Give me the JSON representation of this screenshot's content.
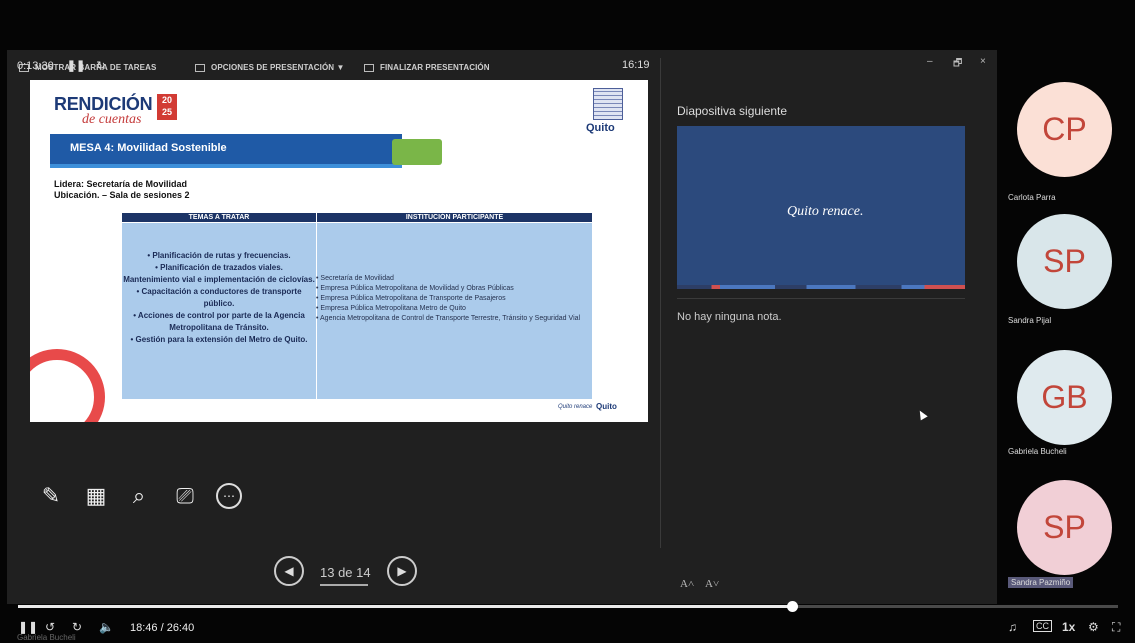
{
  "toolbar": {
    "taskbar": "MOSTRAR BARRA DE TAREAS",
    "options": "OPCIONES DE PRESENTACIÓN ▼",
    "finish": "FINALIZAR PRESENTACIÓN",
    "minimize": "–",
    "restore": "🗗",
    "close": "×"
  },
  "presenter": {
    "elapsed": "0:13:30",
    "clock": "16:19",
    "next_slide_label": "Diapositiva siguiente",
    "notes": "No hay ninguna nota.",
    "page_indicator": "13 de 14",
    "font_increase": "A˄",
    "font_decrease": "A˅"
  },
  "slide": {
    "brand_title": "RENDICIÓN",
    "brand_subtitle": "de cuentas",
    "brand_year": "20 25",
    "logo_word": "Quito",
    "mesa": "MESA 4: Movilidad Sostenible",
    "lidera": "Lidera: Secretaría de Movilidad",
    "ubicacion": "Ubicación. – Sala de sesiones 2",
    "col1_header": "TEMAS A TRATAR",
    "col2_header": "INSTITUCIÓN PARTICIPANTE",
    "temas": "• Planificación de rutas y frecuencias.\n• Planificación de trazados viales.\nMantenimiento vial e implementación de ciclovías.\n• Capacitación a conductores de transporte público.\n• Acciones de control por parte de la Agencia Metropolitana de Tránsito.\n• Gestión para la extensión del Metro de Quito.",
    "instituciones": [
      "Secretaría de Movilidad",
      "Empresa Pública Metropolitana de Movilidad y Obras Públicas",
      "Empresa Pública Metropolitana de Transporte de Pasajeros",
      "Empresa Pública Metropolitana Metro de Quito",
      "Agencia Metropolitana de Control de Transporte Terrestre, Tránsito y Seguridad Vial"
    ],
    "footer_brand": "Quito renace",
    "footer_logo": "Quito"
  },
  "next_slide": {
    "logo_text": "Quito renace."
  },
  "participants": [
    {
      "initials": "CP",
      "name": "Carlota Parra",
      "bg": "#fbe0d6"
    },
    {
      "initials": "SP",
      "name": "Sandra Pijal",
      "bg": "#d9e6ea"
    },
    {
      "initials": "GB",
      "name": "Gabriela Bucheli",
      "bg": "#dfeaee"
    },
    {
      "initials": "SP",
      "name": "Sandra Pazmiño",
      "bg": "#f1cfd6"
    }
  ],
  "player": {
    "current_time": "18:46 / 26:40",
    "speed": "1x",
    "progress": 0.704,
    "watermark": "Gabriela Bucheli"
  }
}
